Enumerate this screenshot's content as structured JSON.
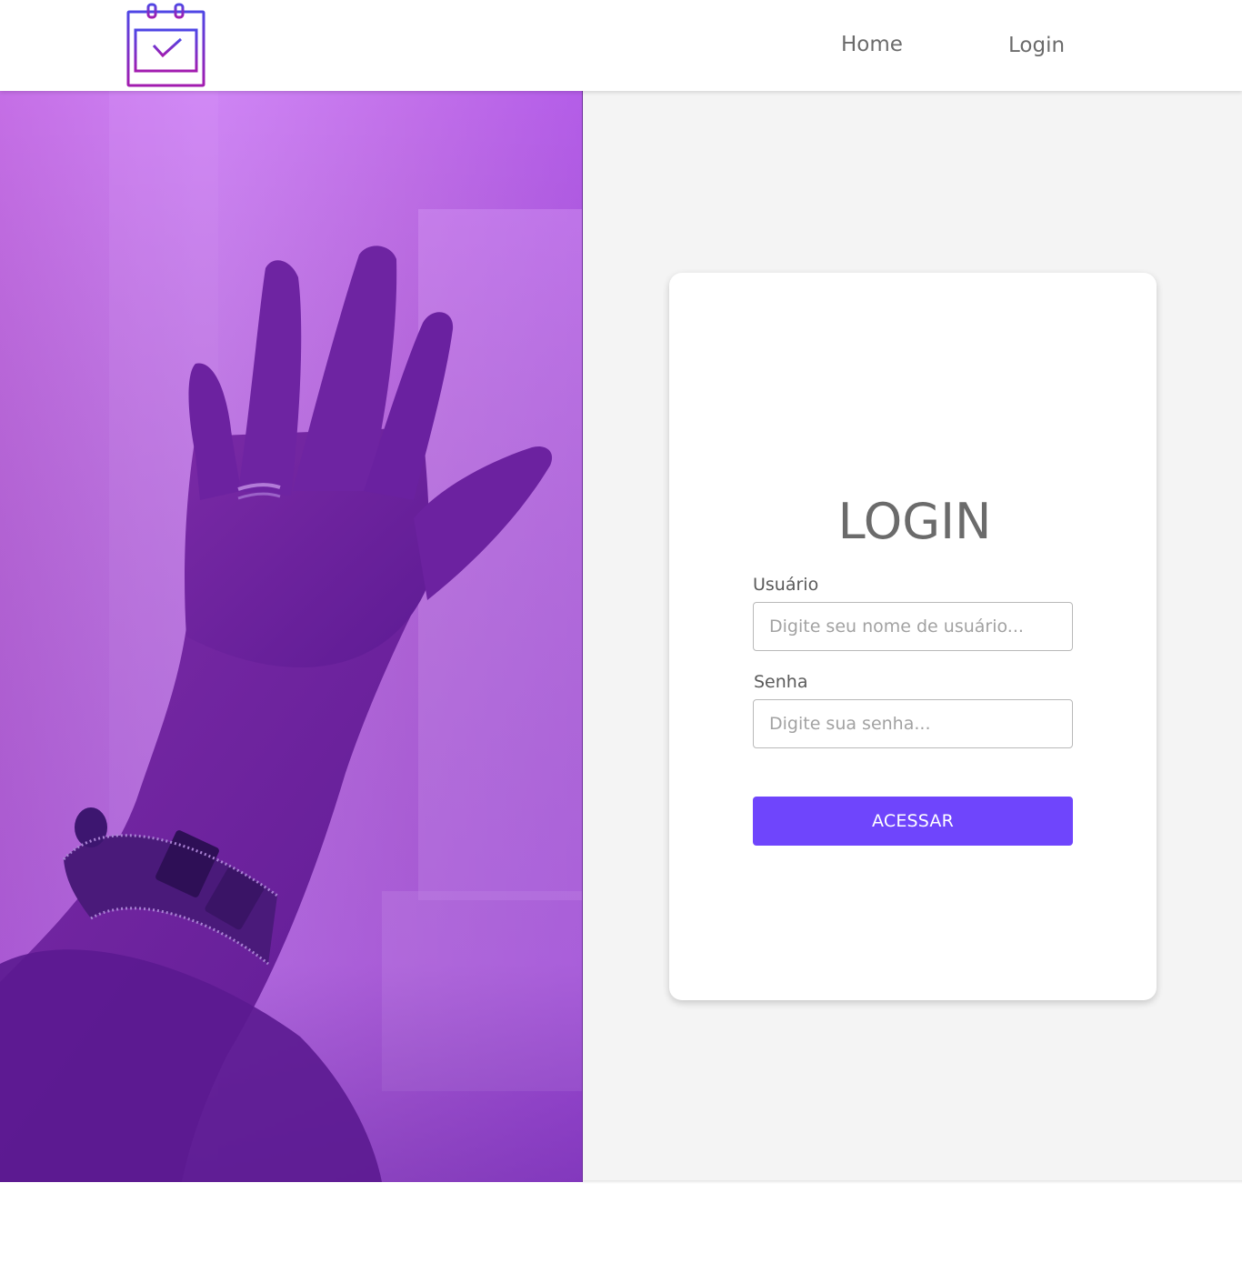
{
  "header": {
    "logo_icon": "calendar-check-icon",
    "nav": {
      "home_label": "Home",
      "login_label": "Login"
    }
  },
  "hero": {
    "image": "raised-hand-with-bracelet-photo",
    "tint_color": "#a855f7"
  },
  "login_card": {
    "title": "LOGIN",
    "username": {
      "label": "Usuário",
      "placeholder": "Digite seu nome de usuário...",
      "value": ""
    },
    "password": {
      "label": "Senha",
      "placeholder": "Digite sua senha...",
      "value": ""
    },
    "submit_label": "ACESSAR"
  },
  "colors": {
    "accent": "#6f45fc",
    "logo_gradient_start": "#4f46e5",
    "logo_gradient_end": "#a21caf",
    "panel_background": "#f4f4f4",
    "text_gray": "#6b6b6b"
  }
}
